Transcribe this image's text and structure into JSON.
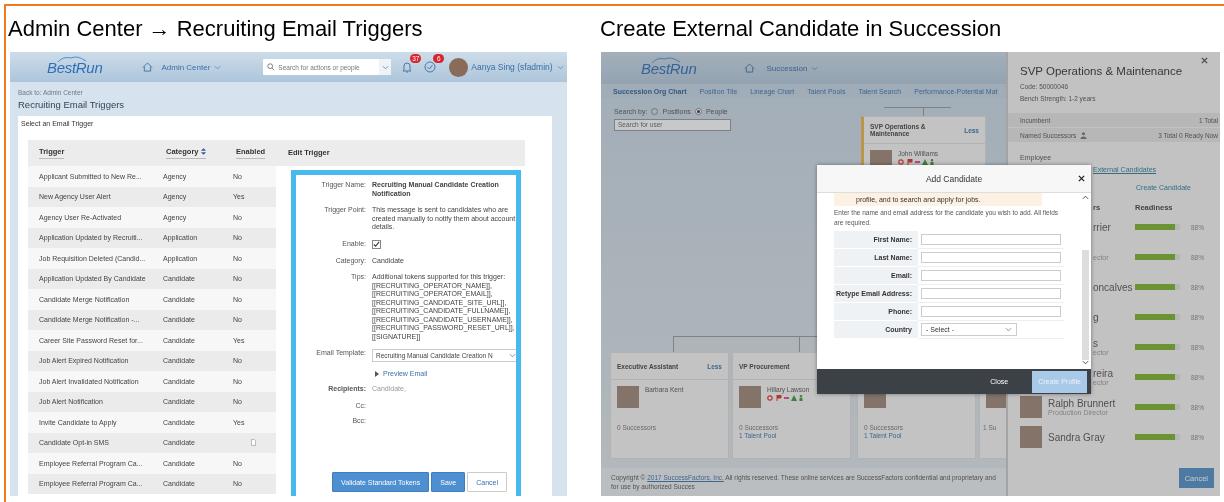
{
  "admin": {
    "title": "Admin Center → Recruiting Email Triggers",
    "logo": "BestRun",
    "menu": "Admin Center",
    "search": {
      "placeholder": "Search for actions or people"
    },
    "notifications": "37",
    "approvals": "6",
    "user": "Aanya Sing (sfadmin)",
    "breadcrumb": "Back to: Admin Center",
    "page_title": "Recruiting Email Triggers",
    "section_title": "Select an Email Trigger",
    "columns": [
      "Trigger",
      "Category",
      "Enabled"
    ],
    "edit_heading": "Edit Trigger",
    "rows": [
      {
        "trigger": "Applicant Submitted to New Re...",
        "category": "Agency",
        "enabled": "No"
      },
      {
        "trigger": "New Agency User Alert",
        "category": "Agency",
        "enabled": "Yes"
      },
      {
        "trigger": "Agency User Re-Activated",
        "category": "Agency",
        "enabled": "No"
      },
      {
        "trigger": "Application Updated by Recruiti...",
        "category": "Application",
        "enabled": "No"
      },
      {
        "trigger": "Job Requisition Deleted (Candid...",
        "category": "Application",
        "enabled": "No"
      },
      {
        "trigger": "Application Updated By Candidate",
        "category": "Candidate",
        "enabled": "No"
      },
      {
        "trigger": "Candidate Merge Notification",
        "category": "Candidate",
        "enabled": "No"
      },
      {
        "trigger": "Candidate Merge Notification -...",
        "category": "Candidate",
        "enabled": "No"
      },
      {
        "trigger": "Career Site Password Reset for...",
        "category": "Candidate",
        "enabled": "Yes"
      },
      {
        "trigger": "Job Alert Expired Notification",
        "category": "Candidate",
        "enabled": "No"
      },
      {
        "trigger": "Job Alert Invalidated Notification",
        "category": "Candidate",
        "enabled": "No"
      },
      {
        "trigger": "Job Alert Notification",
        "category": "Candidate",
        "enabled": "No"
      },
      {
        "trigger": "Invite Candidate to Apply",
        "category": "Candidate",
        "enabled": "Yes"
      },
      {
        "trigger": "Candidate Opt-in SMS",
        "category": "Candidate"
      },
      {
        "trigger": "Employee Referral Program Ca...",
        "category": "Candidate",
        "enabled": "No"
      },
      {
        "trigger": "Employee Referral Program Ca...",
        "category": "Candidate",
        "enabled": "No"
      }
    ],
    "form": [
      {
        "kind": "bold",
        "label": "Trigger Name:",
        "value": "Recruiting Manual Candidate Creation Notification"
      },
      {
        "kind": "text",
        "label": "Trigger Point:",
        "value": "This message is sent to candidates who are created manually to notify them about account details."
      },
      {
        "kind": "checkbox",
        "label": "Enable:",
        "checked": true
      },
      {
        "kind": "text",
        "label": "Category:",
        "value": "Candidate"
      },
      {
        "kind": "lines",
        "label": "Tips:",
        "lines": [
          "Additional tokens supported for this trigger:",
          "[[RECRUITING_OPERATOR_NAME]],",
          "[[RECRUITING_OPERATOR_EMAIL]],",
          "[[RECRUITING_CANDIDATE_SITE_URL]],",
          "[[RECRUITING_CANDIDATE_FULLNAME]],",
          "[[RECRUITING_CANDIDATE_USERNAME]],",
          "[[RECRUITING_PASSWORD_RESET_URL]],",
          "[[SIGNATURE]]"
        ]
      },
      {
        "kind": "select",
        "label": "Email Template:",
        "value": "Recruiting Manual Candidate Creation N"
      },
      {
        "kind": "link",
        "value": "Preview Email"
      },
      {
        "kind": "muted",
        "label": "Recipients:",
        "value": "Candidate,"
      },
      {
        "kind": "empty",
        "label": "Cc:"
      },
      {
        "kind": "empty",
        "label": "Bcc:"
      }
    ],
    "buttons": [
      {
        "label": "Validate Standard Tokens",
        "primary": true
      },
      {
        "label": "Save",
        "primary": true
      },
      {
        "label": "Cancel",
        "primary": false
      }
    ]
  },
  "succession": {
    "title": "Create External Candidate in Succession",
    "logo": "BestRun",
    "menu": "Succession",
    "tabs": [
      {
        "label": "Succession Org Chart",
        "selected": true
      },
      {
        "label": "Position Tile",
        "selected": false
      },
      {
        "label": "Lineage Chart",
        "selected": false
      },
      {
        "label": "Talent Pools",
        "selected": false
      },
      {
        "label": "Talent Search",
        "selected": false
      },
      {
        "label": "Performance-Potential Mat",
        "selected": false
      }
    ],
    "search_by": "Search by:",
    "options": [
      {
        "label": "Positions",
        "selected": false
      },
      {
        "label": "People",
        "selected": true
      }
    ],
    "search": {
      "placeholder": "Search for user"
    },
    "top_card": {
      "title": "SVP Operations & Maintenance",
      "toggle": "Less",
      "person": "John Williams",
      "flags": true
    },
    "cards": [
      {
        "title": "Executive Assistant",
        "toggle": "Less",
        "person": "Barbara Kent",
        "flags": false,
        "successors": "0 Successors"
      },
      {
        "title": "VP Procurement",
        "person": "Hillary Lawson",
        "flags": true,
        "successors": "0 Successors",
        "talent_pool": "1 Talent Pool"
      },
      {
        "flags": true,
        "successors": "0 Successors",
        "talent_pool": "1 Talent Pool"
      },
      {
        "flags": false,
        "successors": "1 Su"
      }
    ],
    "copyright": {
      "prefix": "Copyright ©",
      "link": "2017 SuccessFactors, Inc.",
      "text": "All rights reserved. These online services are SuccessFactors confidential and proprietary and for use by authorized Succes"
    },
    "panel": {
      "title": "SVP Operations & Maintenance",
      "code": "Code: 50000046",
      "bench": "Bench Strength: 1-2 years",
      "stats": [
        {
          "label": "Incumbent",
          "value": "1 Total",
          "kind": "plain"
        },
        {
          "label": "Named Successors",
          "value": "3 Total 0 Ready Now",
          "kind": "people"
        }
      ],
      "employee": "Employee",
      "tab_link": "External Candidates",
      "create_link": "Create Candidate",
      "columns": [
        "rs",
        "Readiness"
      ],
      "successors": [
        {
          "name": "rrier",
          "photo": false,
          "level": 0.88,
          "reading": "88%"
        },
        {
          "role": "ector",
          "photo": false,
          "level": 0.88,
          "reading": "88%"
        },
        {
          "name": "oncalves",
          "photo": false,
          "level": 0.88,
          "reading": "88%"
        },
        {
          "name": "g",
          "photo": false,
          "level": 0.88,
          "reading": "88%"
        },
        {
          "name": "s",
          "role": "ector",
          "photo": false,
          "level": 0.88,
          "reading": "88%"
        },
        {
          "name": "reira",
          "role": "ector",
          "photo": false,
          "level": 0.88,
          "reading": "88%"
        },
        {
          "name": "Ralph Brunnert",
          "role": "Production Director",
          "photo": true,
          "level": 0.88,
          "reading": "88%"
        },
        {
          "name": "Sandra Gray",
          "photo": true,
          "level": 0.88,
          "reading": "88%"
        }
      ],
      "cancel": "Cancel"
    },
    "dialog": {
      "title": "Add Candidate",
      "note": "profile, and to search and apply for jobs.",
      "instruction": "Enter the name and email address for the candidate you wish to add. All fields are required.",
      "fields": [
        {
          "kind": "input",
          "label": "First Name:"
        },
        {
          "kind": "input",
          "label": "Last Name:"
        },
        {
          "kind": "input",
          "label": "Email:"
        },
        {
          "kind": "input",
          "label": "Retype Email Address:"
        },
        {
          "kind": "input",
          "label": "Phone:"
        },
        {
          "kind": "select",
          "label": "Country",
          "value": "- Select -"
        }
      ],
      "buttons": [
        {
          "label": "Close",
          "primary": false,
          "disabled": false
        },
        {
          "label": "Create Profile",
          "primary": true,
          "disabled": true
        }
      ]
    }
  }
}
